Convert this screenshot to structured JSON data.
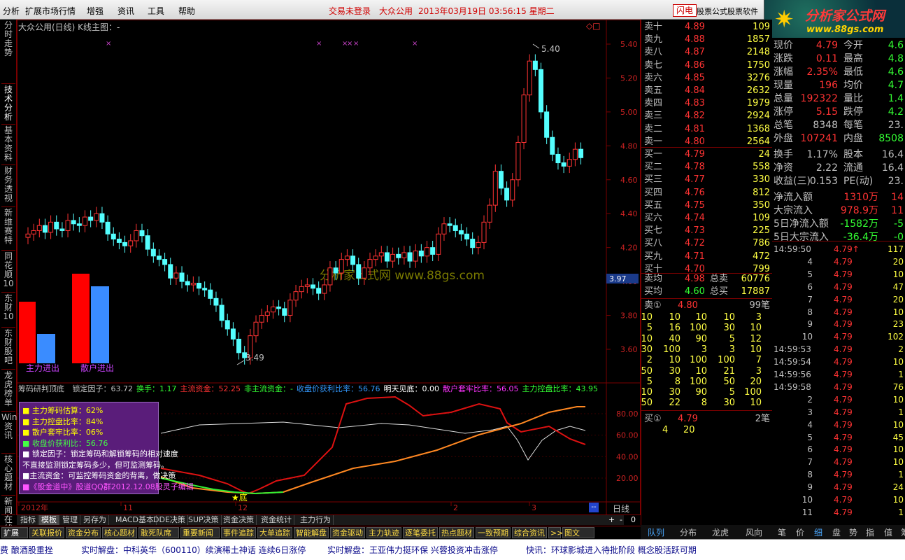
{
  "menu": {
    "items": [
      "分析",
      "扩展市场行情",
      "增强",
      "资讯",
      "工具",
      "帮助"
    ],
    "status_login": "交易未登录",
    "status_stock": "大众公用",
    "status_datetime": "2013年03月19日 03:56:15 星期二",
    "flash_btn": "闪电",
    "soft_label": "股票公式股票软件",
    "logo_title": "分析家公式网",
    "logo_url": "www.88gs.com"
  },
  "left_tabs": [
    "分时走势",
    "技术分析",
    "基本资料",
    "财务透视",
    "新维赛特",
    "同花顺10",
    "东财10",
    "东财股吧",
    "龙虎榜单",
    "Wind资讯",
    "核心题材",
    "新闻在线"
  ],
  "chart": {
    "title": "大众公用(日线) K线主图：-",
    "peak_label": "5.40",
    "low_label": "3.49",
    "price_axis": [
      "5.40",
      "5.20",
      "5.00",
      "4.80",
      "4.60",
      "4.40",
      "4.20",
      "4.00",
      "3.80",
      "3.60"
    ],
    "current_marker": "3.97",
    "watermark": "分析家公式网 www.88gs.com",
    "bar_labels": [
      "主力进出",
      "散户进出"
    ],
    "ind_title": {
      "name": "筹码研判顶底",
      "parts": [
        {
          "t": "锁定因子：63.72",
          "c": "#c0c0c0"
        },
        {
          "t": "换手：1.17",
          "c": "#33ff33"
        },
        {
          "t": "主流资金：52.25",
          "c": "#ff3333"
        },
        {
          "t": "非主流资金：-",
          "c": "#33ff33"
        },
        {
          "t": "收盘价获利比率：56.76",
          "c": "#3399ff"
        },
        {
          "t": "明天见底：0.00",
          "c": "#ffffff"
        },
        {
          "t": "散户套牢比率：56.05",
          "c": "#ff33ff"
        },
        {
          "t": "主力控盘比率：43.95",
          "c": "#33ff33"
        }
      ]
    },
    "ind_axis": [
      "80.00",
      "60.00",
      "40.00",
      "20.00"
    ],
    "legend": [
      {
        "t": "■ 主力筹码估算：62%",
        "c": "#ffff00"
      },
      {
        "t": "■ 主力控盘比率：84%",
        "c": "#ffff00"
      },
      {
        "t": "■ 散户套牢比率：06%",
        "c": "#ffff00"
      },
      {
        "t": "■ 收盘价获利比：56.76",
        "c": "#44ff44"
      },
      {
        "t": "■ 锁定因子：锁定筹码和解锁筹码的相对速度",
        "c": "#ffffff"
      },
      {
        "t": "  不直接监测锁定筹码多少，但可监测筹码。",
        "c": "#ffffff"
      },
      {
        "t": "■主流资金：可监控筹码资金的背离，做决策",
        "c": "#ffffff"
      },
      {
        "t": "■《股金道中》股道QQ群2012.12.08股灵子编辑",
        "c": "#ff55ff"
      }
    ],
    "bottom_label": "★底",
    "date_axis": [
      "2012年",
      "11",
      "12",
      "2",
      "3"
    ],
    "period": "日线",
    "zoom_btns": [
      "+",
      "-",
      "0"
    ]
  },
  "bottom_tabs": [
    "指标",
    "模板",
    "管理",
    "另存为",
    "MACD基本",
    "DDE决策",
    "SUP决策",
    "资金决策",
    "资金统计",
    "主力行为"
  ],
  "row2_tabs": [
    "扩展区",
    "关联报价",
    "资金分布",
    "核心题材",
    "敢死队席位",
    "重要新闻",
    "事件追踪",
    "大单追踪",
    "智能解盘",
    "资金驱动",
    "主力轨迹",
    "逐笔委托",
    "热点题材",
    "一致预期",
    "综合资讯",
    ">>",
    "图文F10"
  ],
  "ticker": [
    "费 酿酒股重挫",
    "实时解盘：中科英华（600110）续演稀土神话 连续6日涨停",
    "实时解盘：王亚伟力挺环保 兴蓉投资冲击涨停",
    "快讯：环球影城进入待批阶段 概念股活跃可期"
  ],
  "orderbook": {
    "sells": [
      [
        "卖十",
        "4.89",
        "109"
      ],
      [
        "卖九",
        "4.88",
        "1857"
      ],
      [
        "卖八",
        "4.87",
        "2148"
      ],
      [
        "卖七",
        "4.86",
        "1750"
      ],
      [
        "卖六",
        "4.85",
        "3276"
      ],
      [
        "卖五",
        "4.84",
        "2632"
      ],
      [
        "卖四",
        "4.83",
        "1979"
      ],
      [
        "卖三",
        "4.82",
        "2924"
      ],
      [
        "卖二",
        "4.81",
        "1368"
      ],
      [
        "卖一",
        "4.80",
        "2564"
      ]
    ],
    "buys": [
      [
        "买一",
        "4.79",
        "24"
      ],
      [
        "买二",
        "4.78",
        "558"
      ],
      [
        "买三",
        "4.77",
        "330"
      ],
      [
        "买四",
        "4.76",
        "812"
      ],
      [
        "买五",
        "4.75",
        "350"
      ],
      [
        "买六",
        "4.74",
        "109"
      ],
      [
        "买七",
        "4.73",
        "225"
      ],
      [
        "买八",
        "4.72",
        "786"
      ],
      [
        "买九",
        "4.71",
        "472"
      ],
      [
        "买十",
        "4.70",
        "799"
      ]
    ],
    "avg": [
      [
        "卖均",
        "4.98",
        "总卖",
        "60776"
      ],
      [
        "买均",
        "4.60",
        "总买",
        "17887"
      ]
    ],
    "sell1_queue_label": [
      "卖①",
      "4.80",
      "99笔"
    ],
    "queue": [
      [
        "10",
        "10",
        "10",
        "10",
        "3"
      ],
      [
        "5",
        "16",
        "100",
        "30",
        "10"
      ],
      [
        "10",
        "40",
        "90",
        "5",
        "12"
      ],
      [
        "30",
        "100",
        "3",
        "3",
        "10"
      ],
      [
        "2",
        "10",
        "100",
        "100",
        "7"
      ],
      [
        "50",
        "30",
        "10",
        "21",
        "3"
      ],
      [
        "5",
        "8",
        "100",
        "50",
        "20"
      ],
      [
        "10",
        "30",
        "90",
        "5",
        "100"
      ],
      [
        "50",
        "22",
        "8",
        "30",
        "10"
      ]
    ],
    "buy1_queue_label": [
      "买①",
      "4.79",
      "2笔"
    ],
    "buy1_queue": [
      "4",
      "20"
    ]
  },
  "stats": [
    [
      "现价",
      "4.79",
      "今开",
      "4.6"
    ],
    [
      "涨跌",
      "0.11",
      "最高",
      "4.8"
    ],
    [
      "涨幅",
      "2.35%",
      "最低",
      "4.6"
    ],
    [
      "现量",
      "196",
      "均价",
      "4.7"
    ],
    [
      "总量",
      "192322",
      "量比",
      "1.4"
    ],
    [
      "涨停",
      "5.15",
      "跌停",
      "4.2"
    ],
    [
      "总笔",
      "8348",
      "每笔",
      "23."
    ],
    [
      "外盘",
      "107241",
      "内盘",
      "8508"
    ],
    [
      "换手",
      "1.17%",
      "股本",
      "16.4"
    ],
    [
      "净资",
      "2.22",
      "流通",
      "16.4"
    ],
    [
      "收益(三)",
      "0.153",
      "PE(动)",
      "23."
    ],
    [
      "净流入额",
      "1310万",
      "14"
    ],
    [
      "大宗流入",
      "978.9万",
      "11"
    ],
    [
      "5日净流入额",
      "-1582万",
      "-5"
    ],
    [
      "5日大宗流入",
      "-36.4万",
      "-0"
    ]
  ],
  "ticks": [
    [
      "14:59:50",
      "4.79↑",
      "117"
    ],
    [
      "4",
      "4.79",
      "20"
    ],
    [
      "5",
      "4.79",
      "10"
    ],
    [
      "6",
      "4.79",
      "47"
    ],
    [
      "7",
      "4.79",
      "20"
    ],
    [
      "8",
      "4.79",
      "10"
    ],
    [
      "9",
      "4.79",
      "23"
    ],
    [
      "10",
      "4.79",
      "102"
    ],
    [
      "14:59:53",
      "4.79",
      "2"
    ],
    [
      "14:59:54",
      "4.79",
      "10"
    ],
    [
      "14:59:56",
      "4.79",
      "1"
    ],
    [
      "14:59:58",
      "4.79",
      "76"
    ],
    [
      "2",
      "4.79",
      "10"
    ],
    [
      "3",
      "4.79",
      "1"
    ],
    [
      "4",
      "4.79",
      "10"
    ],
    [
      "5",
      "4.79",
      "45"
    ],
    [
      "6",
      "4.79",
      "10"
    ],
    [
      "7",
      "4.79",
      "10"
    ],
    [
      "8",
      "4.79",
      "1"
    ],
    [
      "9",
      "4.79",
      "24"
    ],
    [
      "10",
      "4.79",
      "10"
    ],
    [
      "11",
      "4.79",
      "1"
    ]
  ],
  "right_tabs": [
    "队列",
    "分布",
    "龙虎",
    "风向",
    "笔",
    "价",
    "细",
    "盘",
    "势",
    "指",
    "值",
    "筹"
  ],
  "candles": [
    4.28,
    4.3,
    4.33,
    4.29,
    4.35,
    4.31,
    4.3,
    4.36,
    4.34,
    4.33,
    4.38,
    4.36,
    4.4,
    4.35,
    4.28,
    4.25,
    4.23,
    4.21,
    4.24,
    4.3,
    4.27,
    4.19,
    4.15,
    4.13,
    4.1,
    4.02,
    4.05,
    4.0,
    3.98,
    3.99,
    3.96,
    3.95,
    3.9,
    3.86,
    3.77,
    3.72,
    3.66,
    3.58,
    3.55,
    3.68,
    3.76,
    3.8,
    3.82,
    3.85,
    3.84,
    3.8,
    3.89,
    3.94,
    3.97,
    3.98,
    3.96,
    3.93,
    3.98,
    4.08,
    4.05,
    4.13,
    4.15,
    4.1,
    4.02,
    4.08,
    4.13,
    4.15,
    4.17,
    4.12,
    4.16,
    4.14,
    4.17,
    4.12,
    4.18,
    4.15,
    4.2,
    4.16,
    4.28,
    4.34,
    4.33,
    4.3,
    4.28,
    4.25,
    4.2,
    4.23,
    4.35,
    4.45,
    4.65,
    4.55,
    4.48,
    4.6,
    4.82,
    5.1,
    5.3,
    5.25,
    5.0,
    4.85,
    4.75,
    4.7,
    4.68,
    4.72,
    4.78,
    4.73
  ]
}
